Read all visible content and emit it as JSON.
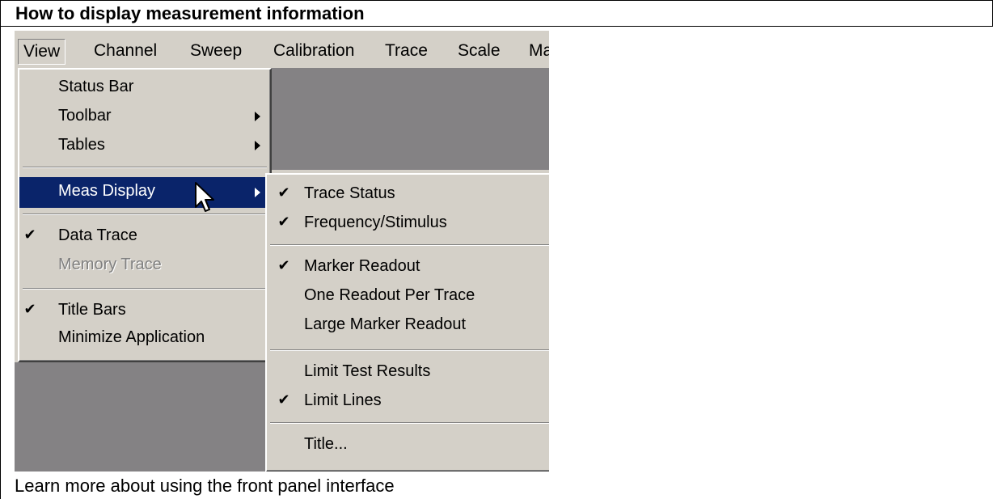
{
  "header": {
    "title": "How to display measurement information"
  },
  "menubar": {
    "items": [
      {
        "label": "View",
        "pressed": true
      },
      {
        "label": "Channel"
      },
      {
        "label": "Sweep"
      },
      {
        "label": "Calibration"
      },
      {
        "label": "Trace"
      },
      {
        "label": "Scale"
      },
      {
        "label": "Ma"
      }
    ]
  },
  "view_menu": {
    "items": [
      {
        "label": "Status Bar"
      },
      {
        "label": "Toolbar",
        "submenu": true
      },
      {
        "label": "Tables",
        "submenu": true
      },
      {
        "label": "Meas Display",
        "submenu": true,
        "highlighted": true
      },
      {
        "label": "Data Trace",
        "checked": true
      },
      {
        "label": "Memory Trace",
        "disabled": true
      },
      {
        "label": "Title Bars",
        "checked": true
      },
      {
        "label": "Minimize Application"
      }
    ]
  },
  "meas_display_menu": {
    "items": [
      {
        "label": "Trace Status",
        "checked": true
      },
      {
        "label": "Frequency/Stimulus",
        "checked": true
      },
      {
        "label": "Marker Readout",
        "checked": true
      },
      {
        "label": "One Readout Per Trace"
      },
      {
        "label": "Large Marker Readout"
      },
      {
        "label": "Limit Test Results"
      },
      {
        "label": "Limit Lines",
        "checked": true
      },
      {
        "label": "Title..."
      }
    ]
  },
  "icons": {
    "check": "✔",
    "submenu_arrow": "triangle-right-icon",
    "cursor": "arrow-cursor-icon"
  },
  "colors": {
    "menu_bg": "#d4d0c8",
    "highlight": "#0a246a",
    "app_workspace": "#848284"
  },
  "footer": {
    "link": "Learn more about using the front panel interface"
  }
}
